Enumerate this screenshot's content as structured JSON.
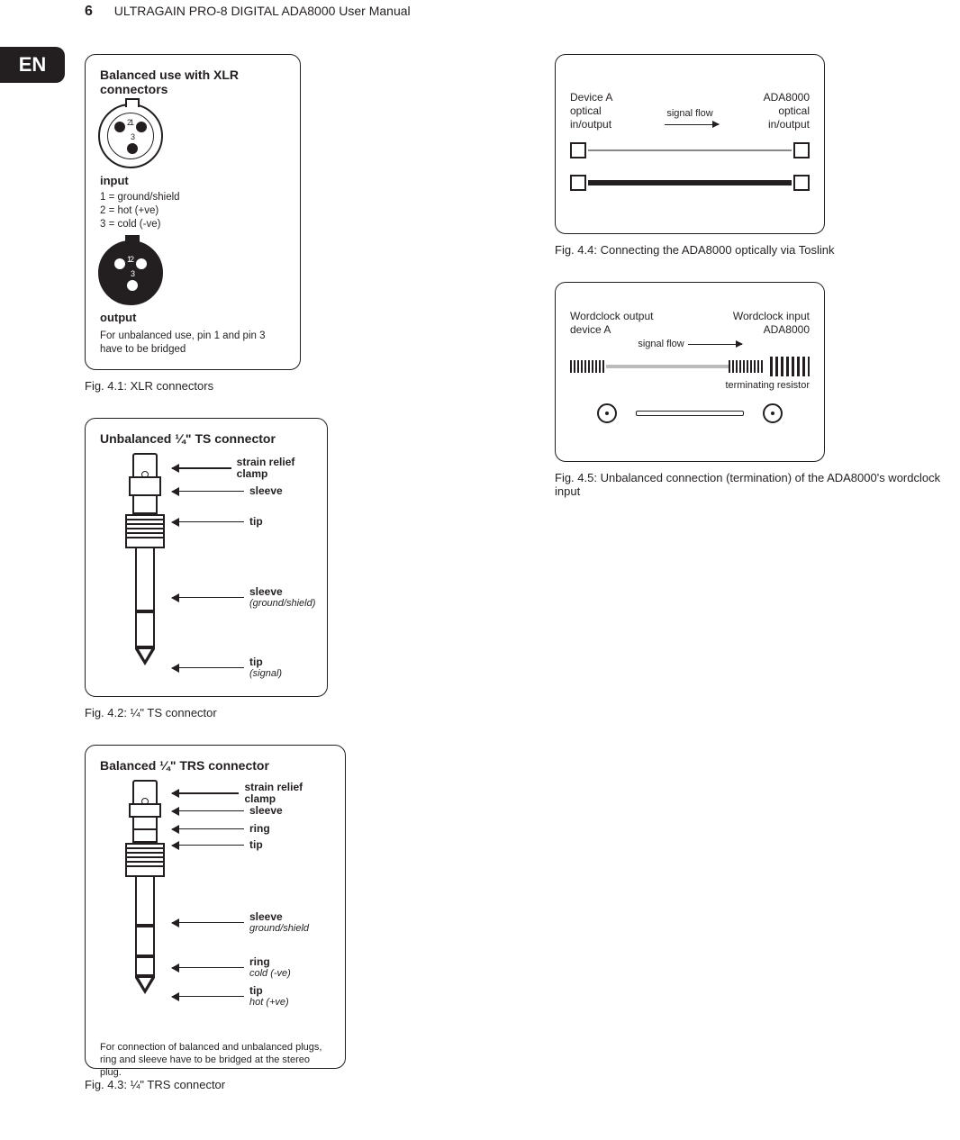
{
  "page_number": "6",
  "doc_title": "ULTRAGAIN PRO-8 DIGITAL ADA8000 User Manual",
  "lang_tab": "EN",
  "fig41": {
    "title": "Balanced use with XLR connectors",
    "input_label": "input",
    "pin_legend_1": "1 = ground/shield",
    "pin_legend_2": "2 = hot (+ve)",
    "pin_legend_3": "3 = cold (-ve)",
    "output_label": "output",
    "note": "For unbalanced use, pin 1 and pin 3 have to be bridged",
    "caption": "Fig. 4.1: XLR connectors",
    "pins": {
      "p1": "1",
      "p2": "2",
      "p3": "3"
    }
  },
  "fig42": {
    "title": "Unbalanced ¼\" TS connector",
    "labels": {
      "strain": "strain relief clamp",
      "sleeve": "sleeve",
      "tip": "tip",
      "sleeve2": "sleeve",
      "sleeve2_sub": "(ground/shield)",
      "tip2": "tip",
      "tip2_sub": "(signal)"
    },
    "caption": "Fig. 4.2: ¼\" TS connector"
  },
  "fig43": {
    "title": "Balanced ¼\" TRS connector",
    "labels": {
      "strain": "strain relief clamp",
      "sleeve": "sleeve",
      "ring": "ring",
      "tip": "tip",
      "sleeve2": "sleeve",
      "sleeve2_sub": "ground/shield",
      "ring2": "ring",
      "ring2_sub": "cold (-ve)",
      "tip2": "tip",
      "tip2_sub": "hot (+ve)"
    },
    "note": "For connection of balanced and unbalanced plugs, ring and sleeve have to be bridged at the stereo plug.",
    "caption": "Fig. 4.3: ¼\" TRS connector"
  },
  "fig44": {
    "left_device_line1": "Device A",
    "left_device_line2": "optical in/output",
    "right_device_line1": "ADA8000",
    "right_device_line2": "optical in/output",
    "signal_flow": "signal flow",
    "caption": "Fig. 4.4: Connecting the ADA8000 optically via Toslink"
  },
  "fig45": {
    "left_line1": "Wordclock output",
    "left_line2": "device A",
    "right_line1": "Wordclock input",
    "right_line2": "ADA8000",
    "signal_flow": "signal flow",
    "term": "terminating resistor",
    "caption": "Fig. 4.5: Unbalanced connection (termination) of the ADA8000's wordclock input"
  }
}
